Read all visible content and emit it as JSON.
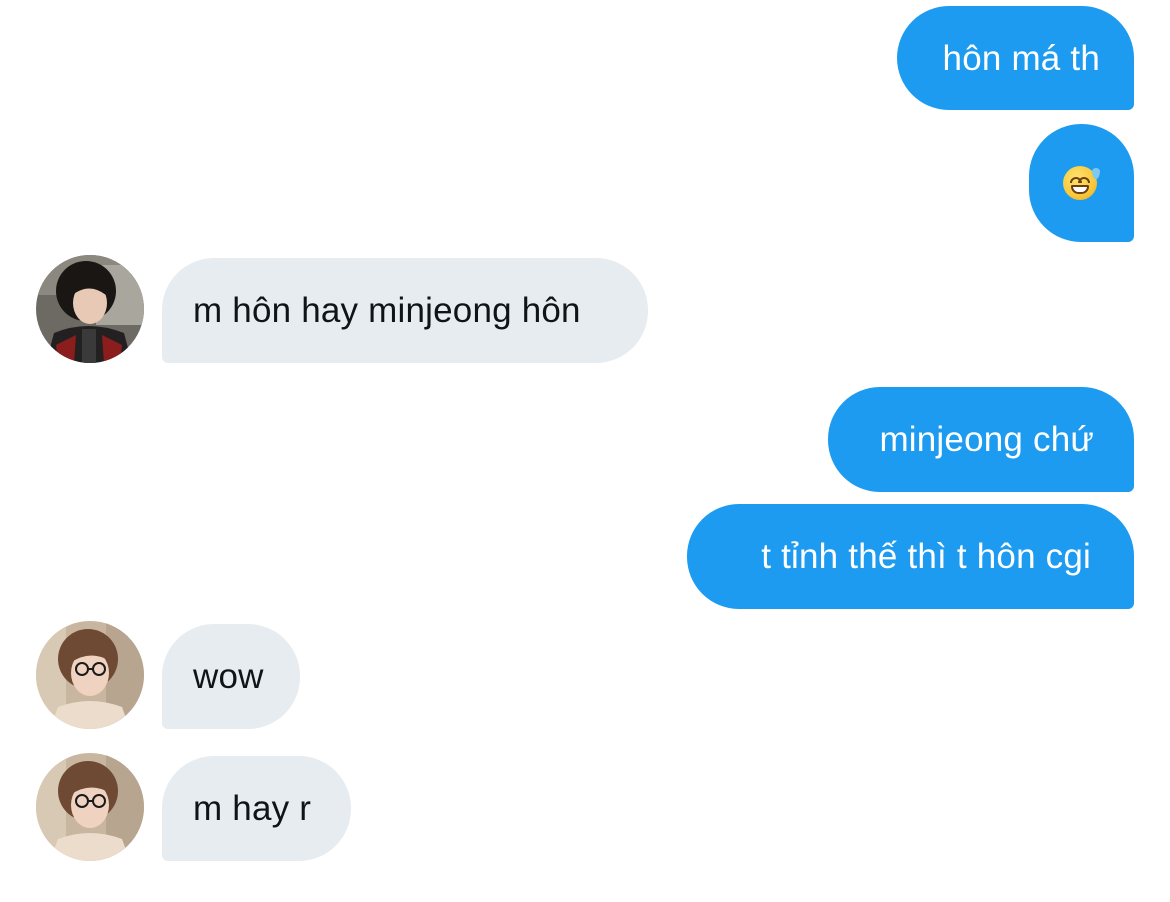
{
  "messages": [
    {
      "direction": "sent",
      "text": "hôn má th"
    },
    {
      "direction": "sent",
      "emoji": "grinning-face-with-sweat-icon"
    },
    {
      "direction": "received",
      "sender_avatar": "avatar-dark-hair",
      "text": "m hôn hay minjeong hôn"
    },
    {
      "direction": "sent",
      "text": "minjeong chứ"
    },
    {
      "direction": "sent",
      "text": "t tỉnh thế thì t hôn cgi"
    },
    {
      "direction": "received",
      "sender_avatar": "avatar-glasses",
      "text": "wow"
    },
    {
      "direction": "received",
      "sender_avatar": "avatar-glasses",
      "text": "m hay r"
    }
  ],
  "colors": {
    "sent_bubble": "#1d9bf0",
    "sent_text": "#ffffff",
    "received_bubble": "#e7ecf0",
    "received_text": "#0f1419",
    "background": "#ffffff"
  }
}
